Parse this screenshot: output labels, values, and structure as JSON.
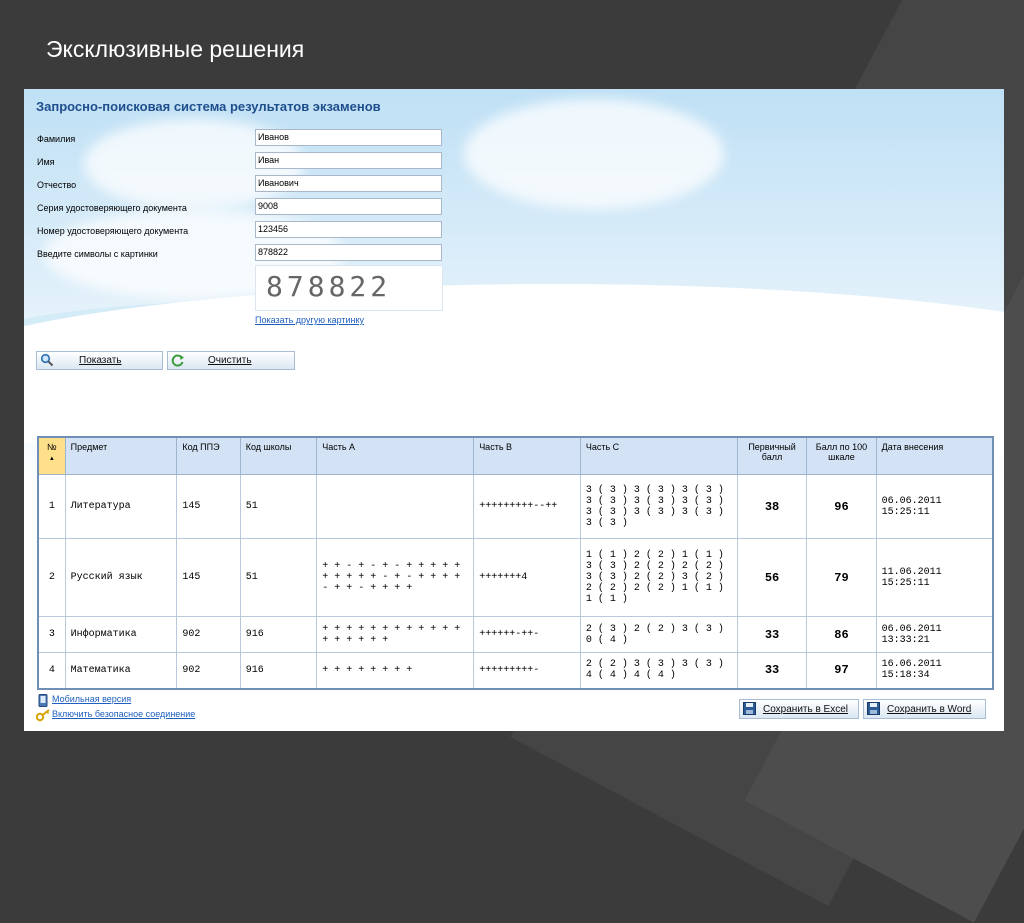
{
  "slide": {
    "title": "Эксклюзивные решения"
  },
  "app": {
    "title": "Запросно-поисковая система результатов экзаменов",
    "form": {
      "surname": {
        "label": "Фамилия",
        "value": "Иванов"
      },
      "name": {
        "label": "Имя",
        "value": "Иван"
      },
      "patronymic": {
        "label": "Отчество",
        "value": "Иванович"
      },
      "doc_series": {
        "label": "Серия удостоверяющего документа",
        "value": "9008"
      },
      "doc_number": {
        "label": "Номер удостоверяющего документа",
        "value": "123456"
      },
      "captcha": {
        "label": "Введите символы с картинки",
        "value": "878822",
        "image_text": "878822"
      },
      "other_image_link": "Показать другую картинку"
    },
    "buttons": {
      "show": "Показать",
      "clear": "Очистить"
    },
    "table": {
      "headers": {
        "num": "№",
        "subject": "Предмет",
        "ppe": "Код ППЭ",
        "school": "Код школы",
        "part_a": "Часть А",
        "part_b": "Часть В",
        "part_c": "Часть С",
        "primary": "Первичный балл",
        "score100": "Балл по 100 шкале",
        "date": "Дата внесения"
      },
      "rows": [
        {
          "num": "1",
          "subject": "Литература",
          "ppe": "145",
          "school": "51",
          "part_a": "",
          "part_b": "+++++++++--++",
          "part_c": "3 ( 3 ) 3 ( 3 ) 3 ( 3 ) 3 ( 3 ) 3 ( 3 ) 3 ( 3 ) 3 ( 3 ) 3 ( 3 ) 3 ( 3 ) 3 ( 3 )",
          "primary": "38",
          "score100": "96",
          "date": "06.06.2011 15:25:11"
        },
        {
          "num": "2",
          "subject": "Русский язык",
          "ppe": "145",
          "school": "51",
          "part_a": "+ + - + - + - + + + + + + + + + + - + - + + + + - + + - + + + +",
          "part_b": "+++++++4",
          "part_c": "1 ( 1 ) 2 ( 2 ) 1 ( 1 ) 3 ( 3 ) 2 ( 2 ) 2 ( 2 ) 3 ( 3 ) 2 ( 2 ) 3 ( 2 ) 2 ( 2 ) 2 ( 2 ) 1 ( 1 ) 1 ( 1 )",
          "primary": "56",
          "score100": "79",
          "date": "11.06.2011 15:25:11"
        },
        {
          "num": "3",
          "subject": "Информатика",
          "ppe": "902",
          "school": "916",
          "part_a": "+ + + + + + + + + + + + + + + + + +",
          "part_b": "++++++-++-",
          "part_c": "2 ( 3 ) 2 ( 2 ) 3 ( 3 ) 0 ( 4 )",
          "primary": "33",
          "score100": "86",
          "date": "06.06.2011 13:33:21"
        },
        {
          "num": "4",
          "subject": "Математика",
          "ppe": "902",
          "school": "916",
          "part_a": "+ + + + + + + +",
          "part_b": "+++++++++-",
          "part_c": "2 ( 2 ) 3 ( 3 ) 3 ( 3 ) 4 ( 4 ) 4 ( 4 )",
          "primary": "33",
          "score100": "97",
          "date": "16.06.2011 15:18:34"
        }
      ]
    },
    "links": {
      "mobile": "Мобильная версия",
      "secure": "Включить безопасное соединение"
    },
    "save": {
      "excel": "Сохранить в Excel",
      "word": "Сохранить в Word"
    }
  }
}
